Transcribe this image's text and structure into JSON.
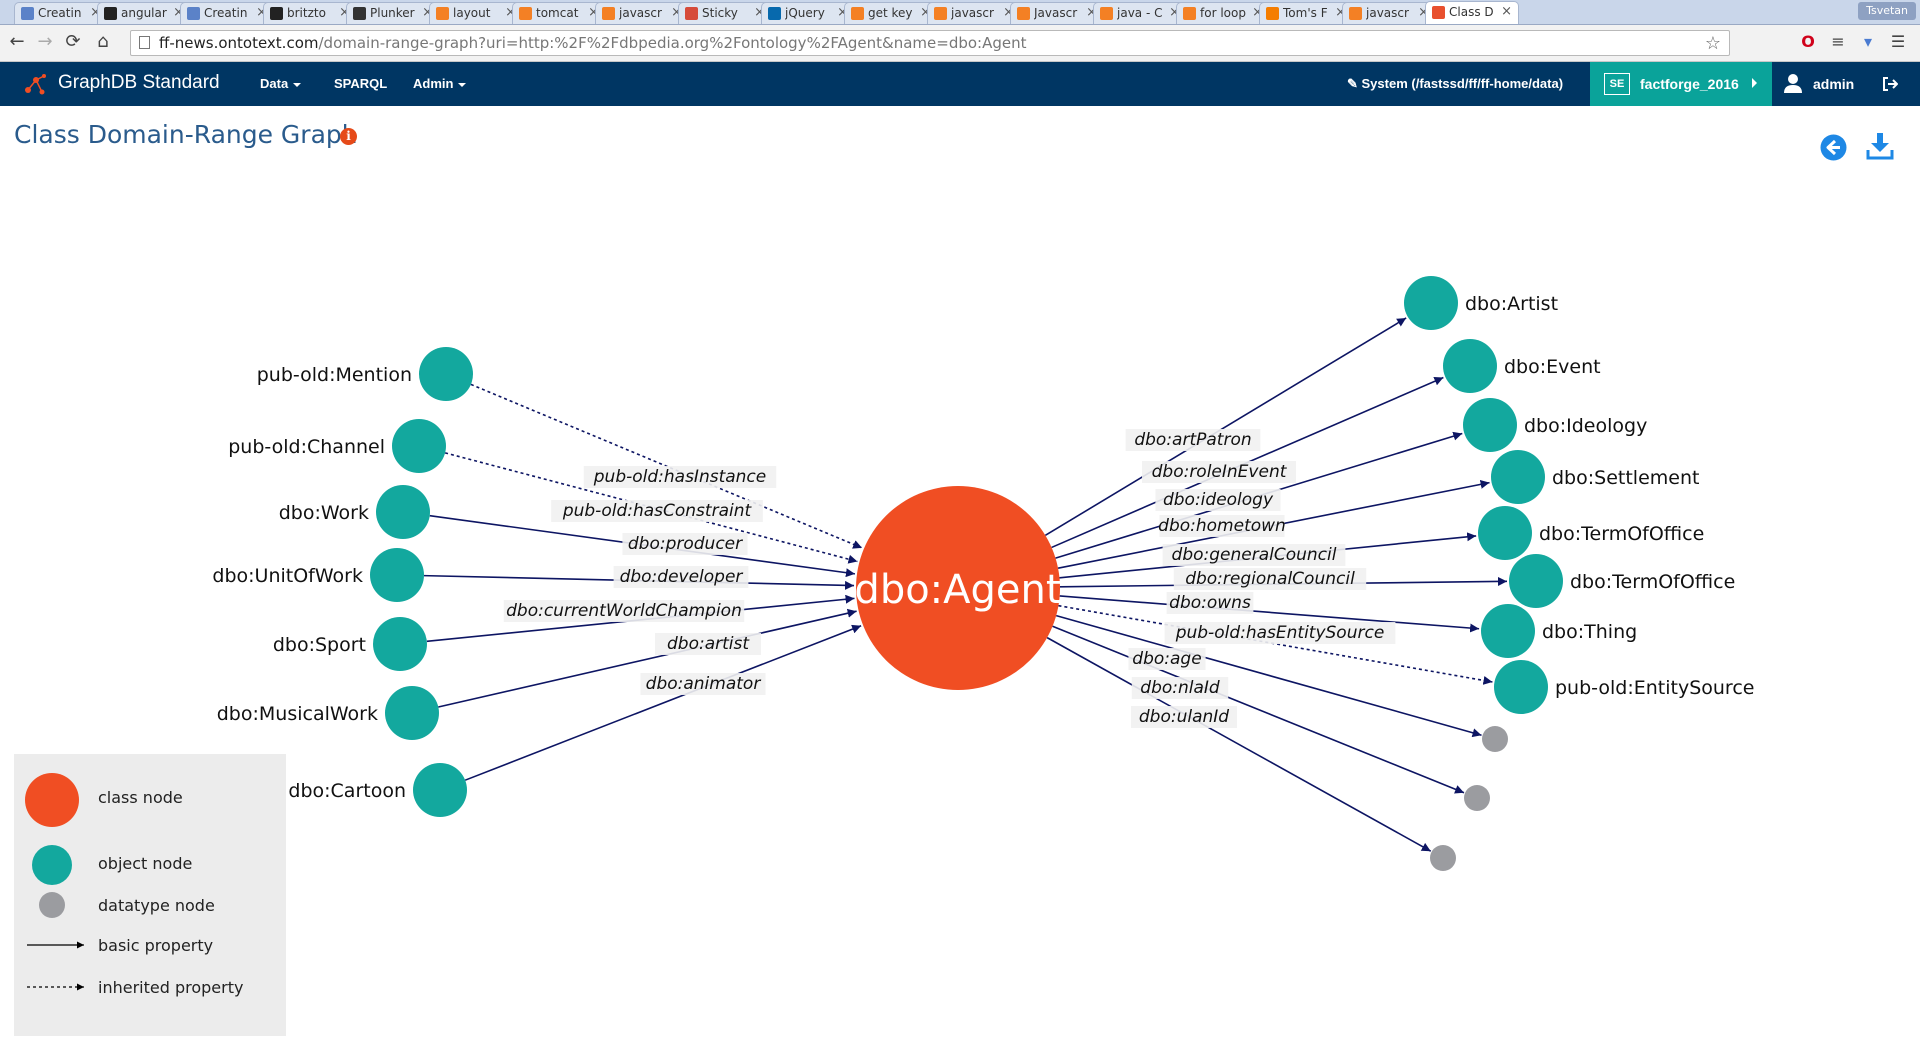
{
  "browser": {
    "tabs": [
      {
        "label": "Creatin",
        "icon": "document-icon",
        "color": "#5b82c8"
      },
      {
        "label": "angular",
        "icon": "github-icon",
        "color": "#222222"
      },
      {
        "label": "Creatin",
        "icon": "document-icon",
        "color": "#5b82c8"
      },
      {
        "label": "britzto",
        "icon": "github-icon",
        "color": "#222222"
      },
      {
        "label": "Plunker",
        "icon": "plunker-icon",
        "color": "#333333"
      },
      {
        "label": "layout",
        "icon": "stackoverflow-icon",
        "color": "#f48024"
      },
      {
        "label": "tomcat",
        "icon": "stackoverflow-icon",
        "color": "#f48024"
      },
      {
        "label": "javascr",
        "icon": "stackoverflow-icon",
        "color": "#f48024"
      },
      {
        "label": "Sticky",
        "icon": "chrome-icon",
        "color": "#d64b3a"
      },
      {
        "label": "jQuery",
        "icon": "jquery-icon",
        "color": "#0769ad"
      },
      {
        "label": "get key",
        "icon": "stackoverflow-icon",
        "color": "#f48024"
      },
      {
        "label": "javascr",
        "icon": "stackoverflow-icon",
        "color": "#f48024"
      },
      {
        "label": "Javascr",
        "icon": "stackoverflow-icon",
        "color": "#f48024"
      },
      {
        "label": "java - C",
        "icon": "stackoverflow-icon",
        "color": "#f48024"
      },
      {
        "label": "for loop",
        "icon": "stackoverflow-icon",
        "color": "#f48024"
      },
      {
        "label": "Tom's F",
        "icon": "blogger-icon",
        "color": "#f57d00"
      },
      {
        "label": "javascr",
        "icon": "stackoverflow-icon",
        "color": "#f48024"
      },
      {
        "label": "Class D",
        "icon": "graphdb-icon",
        "color": "#e8502e",
        "active": true
      }
    ],
    "user_badge": "Tsvetan",
    "url_host": "ff-news.ontotext.com",
    "url_path": "/domain-range-graph?uri=http:%2F%2Fdbpedia.org%2Fontology%2FAgent&name=dbo:Agent"
  },
  "app": {
    "brand": "GraphDB Standard",
    "menu": [
      "Data",
      "SPARQL",
      "Admin"
    ],
    "system_info": "System (/fastssd/ff/ff-home/data)",
    "repo_badge": "SE",
    "repo_name": "factforge_2016",
    "user": "admin",
    "accent_color": "#0aa39a",
    "nav_color": "#003663"
  },
  "page": {
    "title": "Class Domain-Range Graph",
    "info_icon": "i"
  },
  "graph": {
    "center": {
      "label": "dbo:Agent",
      "color": "#f04e23"
    },
    "incoming": [
      {
        "node": "pub-old:Mention",
        "property": "pub-old:hasInstance",
        "inherited": true
      },
      {
        "node": "pub-old:Channel",
        "property": "pub-old:hasConstraint",
        "inherited": true
      },
      {
        "node": "dbo:Work",
        "property": "dbo:producer",
        "inherited": false
      },
      {
        "node": "dbo:UnitOfWork",
        "property": "dbo:developer",
        "inherited": false
      },
      {
        "node": "dbo:Sport",
        "property": "dbo:currentWorldChampion",
        "inherited": false
      },
      {
        "node": "dbo:MusicalWork",
        "property": "dbo:artist",
        "inherited": false
      },
      {
        "node": "dbo:Cartoon",
        "property": "dbo:animator",
        "inherited": false
      }
    ],
    "outgoing": [
      {
        "node": "dbo:Artist",
        "property": "dbo:artPatron",
        "inherited": false,
        "type": "object"
      },
      {
        "node": "dbo:Event",
        "property": "dbo:roleInEvent",
        "inherited": false,
        "type": "object"
      },
      {
        "node": "dbo:Ideology",
        "property": "dbo:ideology",
        "inherited": false,
        "type": "object"
      },
      {
        "node": "dbo:Settlement",
        "property": "dbo:hometown",
        "inherited": false,
        "type": "object"
      },
      {
        "node": "dbo:TermOfOffice",
        "property": "dbo:generalCouncil",
        "inherited": false,
        "type": "object"
      },
      {
        "node": "dbo:TermOfOffice",
        "property": "dbo:regionalCouncil",
        "inherited": false,
        "type": "object"
      },
      {
        "node": "dbo:Thing",
        "property": "dbo:owns",
        "inherited": false,
        "type": "object"
      },
      {
        "node": "pub-old:EntitySource",
        "property": "pub-old:hasEntitySource",
        "inherited": true,
        "type": "object"
      },
      {
        "node": "",
        "property": "dbo:age",
        "inherited": false,
        "type": "datatype"
      },
      {
        "node": "",
        "property": "dbo:nlaId",
        "inherited": false,
        "type": "datatype"
      },
      {
        "node": "",
        "property": "dbo:ulanId",
        "inherited": false,
        "type": "datatype"
      }
    ],
    "colors": {
      "class": "#f04e23",
      "object": "#13a89e",
      "datatype": "#9b9ca0",
      "edge": "#0d1563"
    }
  },
  "legend": {
    "class_node": "class node",
    "object_node": "object node",
    "datatype_node": "datatype node",
    "basic_property": "basic property",
    "inherited_property": "inherited property"
  }
}
